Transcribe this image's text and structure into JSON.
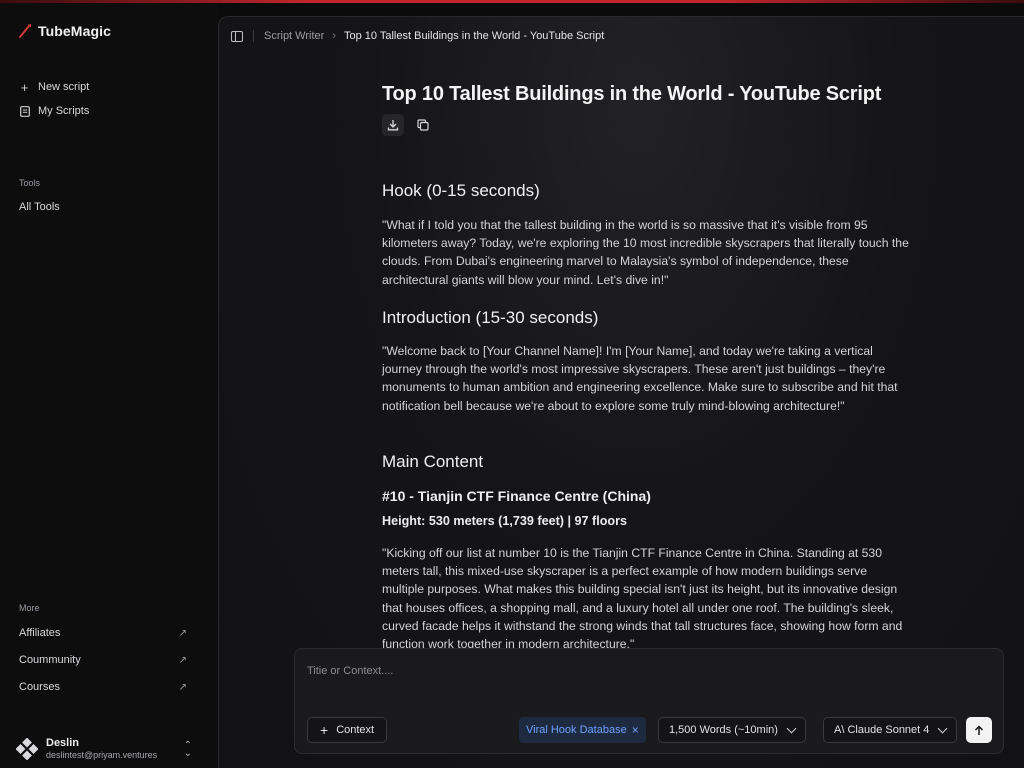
{
  "app": {
    "name": "TubeMagic",
    "accent_color": "#c0262d"
  },
  "sidebar": {
    "primary": [
      {
        "label": "New script",
        "icon": "plus-icon"
      },
      {
        "label": "My Scripts",
        "icon": "document-icon"
      }
    ],
    "tools_heading": "Tools",
    "all_tools": "All Tools",
    "more_heading": "More",
    "more": [
      {
        "label": "Affiliates",
        "icon": "external-arrow-icon"
      },
      {
        "label": "Coummunity",
        "icon": "external-arrow-icon"
      },
      {
        "label": "Courses",
        "icon": "external-arrow-icon"
      }
    ],
    "user": {
      "name": "Deslin",
      "email": "deslintest@priyam.ventures"
    }
  },
  "breadcrumb": {
    "parent": "Script Writer",
    "current": "Top 10 Tallest Buildings in the World - YouTube Script"
  },
  "document": {
    "title": "Top 10 Tallest Buildings in the World - YouTube Script",
    "hook_heading": "Hook (0-15 seconds)",
    "hook_text": "\"What if I told you that the tallest building in the world is so massive that it's visible from 95 kilometers away? Today, we're exploring the 10 most incredible skyscrapers that literally touch the clouds. From Dubai's engineering marvel to Malaysia's symbol of independence, these architectural giants will blow your mind. Let's dive in!\"",
    "intro_heading": "Introduction (15-30 seconds)",
    "intro_text": "\"Welcome back to [Your Channel Name]! I'm [Your Name], and today we're taking a vertical journey through the world's most impressive skyscrapers. These aren't just buildings – they're monuments to human ambition and engineering excellence. Make sure to subscribe and hit that notification bell because we're about to explore some truly mind-blowing architecture!\"",
    "main_heading": "Main Content",
    "item_heading": "#10 - Tianjin CTF Finance Centre (China)",
    "item_height": "Height: 530 meters (1,739 feet) | 97 floors",
    "item_text": "\"Kicking off our list at number 10 is the Tianjin CTF Finance Centre in China. Standing at 530 meters tall, this mixed-use skyscraper is a perfect example of how modern buildings serve multiple purposes. What makes this building special isn't just its height, but its innovative design that houses offices, a shopping mall, and a luxury hotel all under one roof. The building's sleek, curved facade helps it withstand the strong winds that tall structures face, showing how form and function work together in modern architecture.\""
  },
  "composer": {
    "placeholder": "Titie or Context....",
    "context_label": "Context",
    "tag_label": "Viral Hook Database",
    "length_label": "1,500 Words (~10min)",
    "model_label": "A\\ Claude Sonnet 4",
    "tag_color": "#6ea1ff"
  }
}
